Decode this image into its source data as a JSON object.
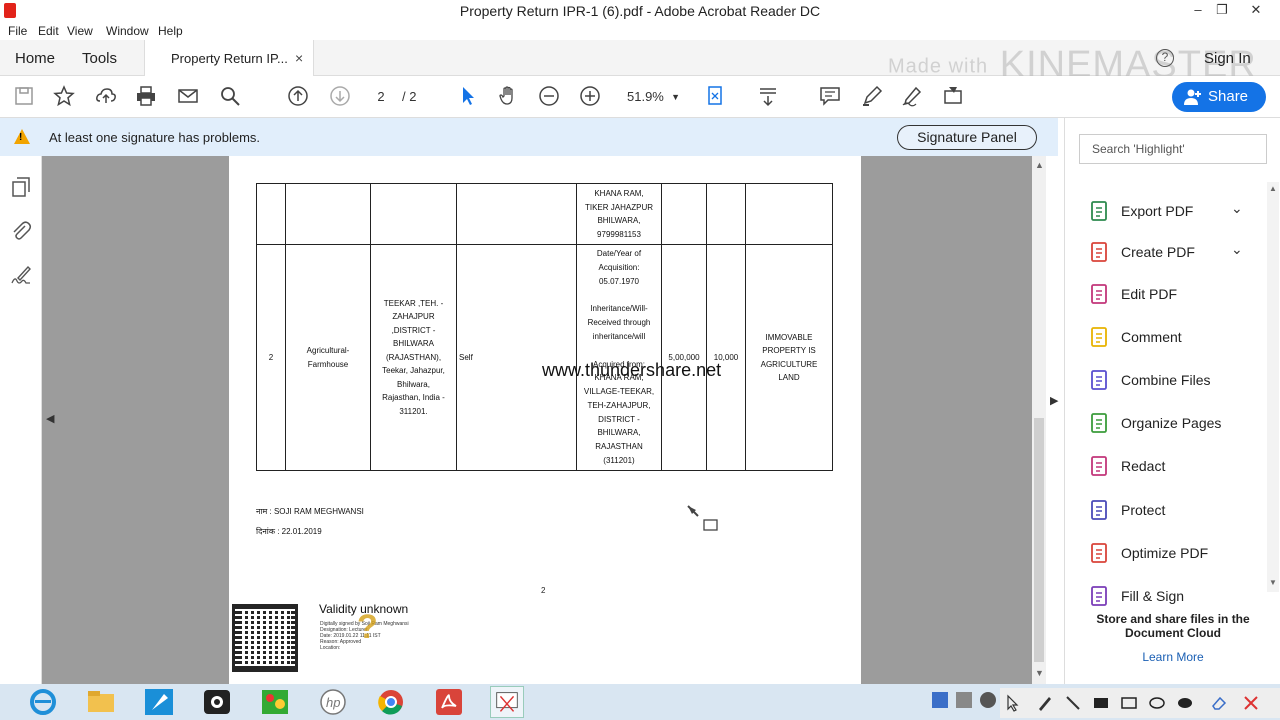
{
  "window": {
    "title": "Property Return IPR-1 (6).pdf - Adobe Acrobat Reader DC",
    "minimize": "–",
    "restore": "❐",
    "close": "✕"
  },
  "menu": [
    "File",
    "Edit",
    "View",
    "Window",
    "Help"
  ],
  "tabs": {
    "home": "Home",
    "tools": "Tools",
    "document": "Property Return IP...",
    "close": "×"
  },
  "watermark": {
    "small": "Made with",
    "big": "KINEMASTER"
  },
  "header": {
    "sign_in": "Sign In",
    "help": "?"
  },
  "toolbar": {
    "page_current": "2",
    "page_total": "/ 2",
    "zoom": "51.9%",
    "zoom_caret": "▼",
    "share": "Share"
  },
  "signature_bar": {
    "message": "At least one signature has problems.",
    "button": "Signature Panel"
  },
  "document": {
    "row1": {
      "col5": "KHANA RAM,\nTIKER JAHAZPUR\nBHILWARA,\n9799981153"
    },
    "row2": {
      "num": "2",
      "type": "Agricultural-\nFarmhouse",
      "address": "TEEKAR ,TEH. -\nZAHAJPUR\n,DISTRICT -\nBHILWARA\n(RAJASTHAN),\nTeekar, Jahazpur,\nBhilwara,\nRajasthan, India -\n311201.",
      "owner": "Self",
      "acquisition": "Date/Year of\nAcquisition:\n05.07.1970\n\nInheritance/Will-\nReceived through\ninheritance/will\n\nAcquired from:\nKHANA RAM,\nVILLAGE-TEEKAR,\nTEH-ZAHAJPUR,\nDISTRICT -\nBHILWARA,\nRAJASTHAN\n(311201)",
      "value": "5,00,000",
      "income": "10,000",
      "remarks": "IMMOVABLE\nPROPERTY IS\nAGRICULTURE\nLAND"
    },
    "name_line": "नाम : SOJI RAM MEGHWANSI",
    "date_line": "दिनांक : 22.01.2019",
    "page_number": "2",
    "validity": "Validity unknown",
    "signature_details": "Digitally signed by Soji Ram Meghwansi\nDesignation: Lecturer\nDate: 2019.01.22 11:11 IST\nReason: Approved\nLocation:",
    "site_watermark": "www.thundershare.net"
  },
  "right_pane": {
    "search_placeholder": "Search 'Highlight'",
    "tools": [
      {
        "label": "Export PDF",
        "color": "#2d8a4e",
        "has_chevron": true
      },
      {
        "label": "Create PDF",
        "color": "#d9443a",
        "has_chevron": true
      },
      {
        "label": "Edit PDF",
        "color": "#c2367a",
        "has_chevron": false
      },
      {
        "label": "Comment",
        "color": "#e8b300",
        "has_chevron": false
      },
      {
        "label": "Combine Files",
        "color": "#5a4fcf",
        "has_chevron": false
      },
      {
        "label": "Organize Pages",
        "color": "#3b9c3b",
        "has_chevron": false
      },
      {
        "label": "Redact",
        "color": "#c2367a",
        "has_chevron": false
      },
      {
        "label": "Protect",
        "color": "#4a4ab8",
        "has_chevron": false
      },
      {
        "label": "Optimize PDF",
        "color": "#d9443a",
        "has_chevron": false
      },
      {
        "label": "Fill & Sign",
        "color": "#7a3db8",
        "has_chevron": false
      }
    ],
    "chevron": "⌄",
    "store_text": "Store and share files in the Document Cloud",
    "learn_more": "Learn More"
  },
  "colors": {
    "accent": "#1473e6",
    "warning": "#f2a400",
    "signature_bar_bg": "#e1eefb",
    "doc_bg": "#9c9c9c"
  }
}
